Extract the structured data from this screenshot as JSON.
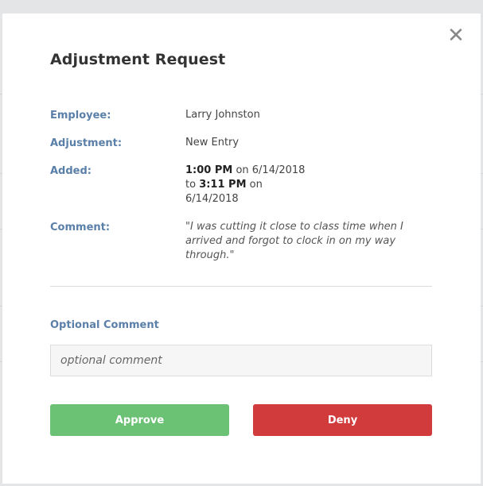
{
  "modal": {
    "title": "Adjustment Request",
    "close_glyph": "✕",
    "fields": {
      "employee": {
        "label": "Employee:",
        "value": "Larry Johnston"
      },
      "adjustment": {
        "label": "Adjustment:",
        "value": "New Entry"
      },
      "added": {
        "label": "Added:",
        "start_time": "1:00 PM",
        "start_on": " on 6/14/2018",
        "to_prefix": "to ",
        "end_time": "3:11 PM",
        "end_on": " on",
        "end_date": "6/14/2018"
      },
      "comment": {
        "label": "Comment:",
        "value": "\"I was cutting it close to class time when I arrived and forgot to clock in on my way through.\""
      }
    },
    "optional_comment": {
      "label": "Optional Comment",
      "placeholder": "optional comment",
      "value": ""
    },
    "buttons": {
      "approve": "Approve",
      "deny": "Deny"
    }
  },
  "icons": {
    "close": "close-icon"
  },
  "colors": {
    "label": "#5a7fa8",
    "approve": "#6cc274",
    "deny": "#d23b3b"
  }
}
